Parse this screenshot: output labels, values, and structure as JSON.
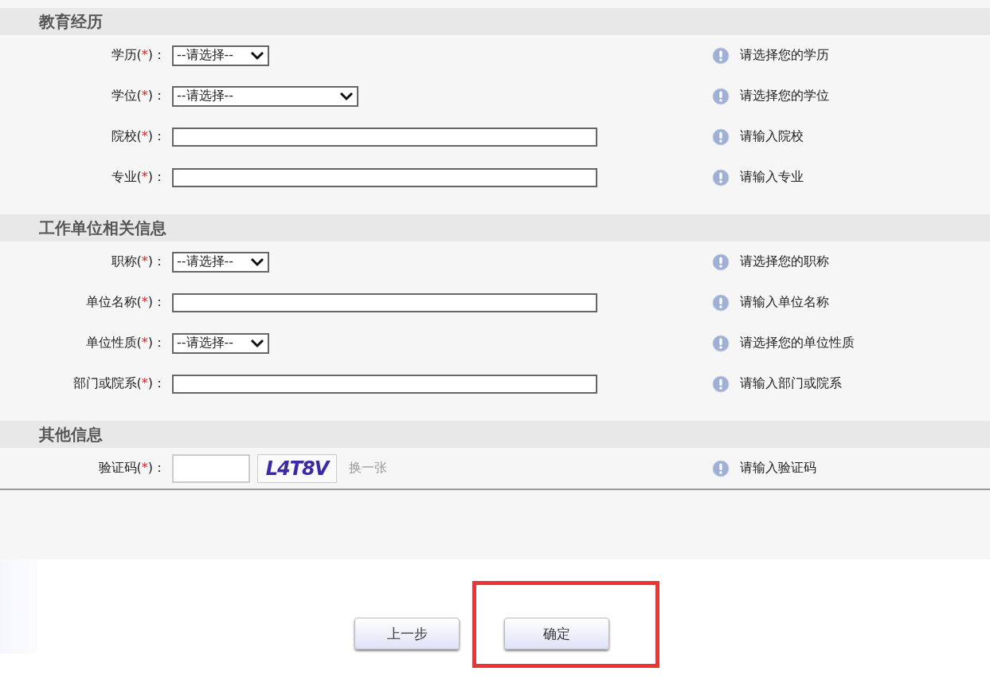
{
  "sections": [
    {
      "title": "教育经历",
      "fields": [
        {
          "kind": "select",
          "label_start": "学历(",
          "required_mark": "*",
          "label_end": ")：",
          "value": "--请选择--",
          "hint": "请选择您的学历"
        },
        {
          "kind": "wideselect",
          "label_start": "学位(",
          "required_mark": "*",
          "label_end": ")：",
          "value": "--请选择--",
          "hint": "请选择您的学位"
        },
        {
          "kind": "text",
          "label_start": "院校(",
          "required_mark": "*",
          "label_end": ")：",
          "hint": "请输入院校"
        },
        {
          "kind": "text",
          "label_start": "专业(",
          "required_mark": "*",
          "label_end": ")：",
          "hint": "请输入专业"
        }
      ]
    },
    {
      "title": "工作单位相关信息",
      "fields": [
        {
          "kind": "select",
          "label_start": "职称(",
          "required_mark": "*",
          "label_end": ")：",
          "value": "--请选择--",
          "hint": "请选择您的职称"
        },
        {
          "kind": "text",
          "label_start": "单位名称(",
          "required_mark": "*",
          "label_end": ")：",
          "hint": "请输入单位名称"
        },
        {
          "kind": "select",
          "label_start": "单位性质(",
          "required_mark": "*",
          "label_end": ")：",
          "value": "--请选择--",
          "hint": "请选择您的单位性质"
        },
        {
          "kind": "text",
          "label_start": "部门或院系(",
          "required_mark": "*",
          "label_end": ")：",
          "hint": "请输入部门或院系"
        }
      ]
    },
    {
      "title": "其他信息",
      "fields": [
        {
          "kind": "captcha",
          "label_start": "验证码(",
          "required_mark": "*",
          "label_end": ")：",
          "captcha_text": "L4T8V",
          "refresh_link": "换一张",
          "hint": "请输入验证码"
        }
      ]
    }
  ],
  "buttons": [
    {
      "label": "上一步",
      "highlighted": false
    },
    {
      "label": "确定",
      "highlighted": true
    }
  ]
}
